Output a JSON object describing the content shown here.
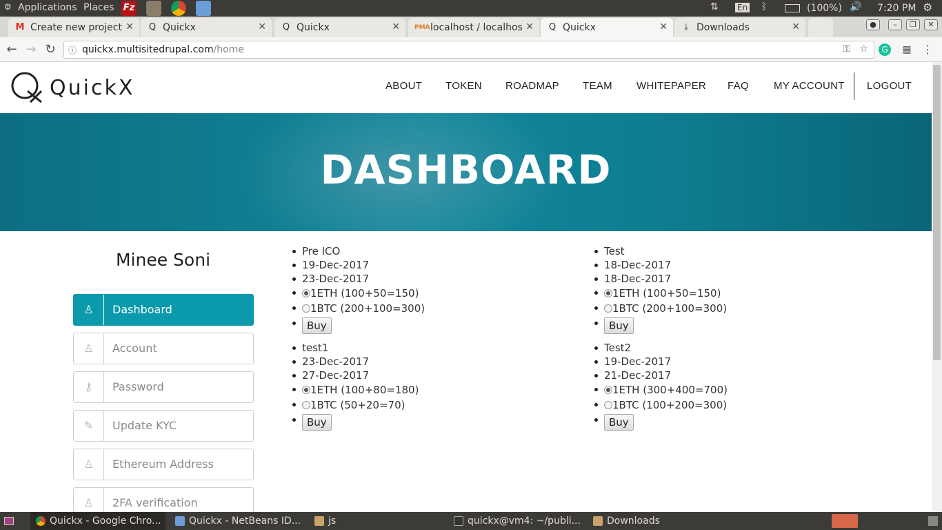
{
  "os": {
    "menus": [
      "Applications",
      "Places"
    ],
    "tray": {
      "battery": "(100%)",
      "keyboard": "En",
      "time": "7:20 PM"
    }
  },
  "browser": {
    "tabs": [
      {
        "title": "Create new project",
        "icon": "gmail-icon"
      },
      {
        "title": "Quickx",
        "icon": "quickx-icon"
      },
      {
        "title": "Quickx",
        "icon": "quickx-icon"
      },
      {
        "title": "localhost / localhos",
        "icon": "phpmyadmin-icon"
      },
      {
        "title": "Quickx",
        "icon": "quickx-icon",
        "active": true
      },
      {
        "title": "Downloads",
        "icon": "download-icon"
      }
    ],
    "url": {
      "host": "quickx.multisitedrupal.com",
      "path": "/home"
    }
  },
  "site": {
    "logo": "QuickX",
    "nav": [
      "ABOUT",
      "TOKEN",
      "ROADMAP",
      "TEAM",
      "WHITEPAPER",
      "FAQ",
      "MY ACCOUNT",
      "LOGOUT"
    ],
    "hero_title": "DASHBOARD",
    "user_name": "Minee Soni",
    "menu": [
      {
        "label": "Dashboard",
        "icon": "user-icon",
        "active": true
      },
      {
        "label": "Account",
        "icon": "user-icon"
      },
      {
        "label": "Password",
        "icon": "key-icon"
      },
      {
        "label": "Update KYC",
        "icon": "pencil-icon"
      },
      {
        "label": "Ethereum Address",
        "icon": "user-icon"
      },
      {
        "label": "2FA verification",
        "icon": "user-icon"
      }
    ],
    "icos": [
      {
        "name": "Pre ICO",
        "start": "19-Dec-2017",
        "end": "23-Dec-2017",
        "eth": "1ETH (100+50=150)",
        "btc": "1BTC (200+100=300)",
        "buy": "Buy"
      },
      {
        "name": "Test",
        "start": "18-Dec-2017",
        "end": "18-Dec-2017",
        "eth": "1ETH (100+50=150)",
        "btc": "1BTC (200+100=300)",
        "buy": "Buy"
      },
      {
        "name": "test1",
        "start": "23-Dec-2017",
        "end": "27-Dec-2017",
        "eth": "1ETH (100+80=180)",
        "btc": "1BTC (50+20=70)",
        "buy": "Buy"
      },
      {
        "name": "Test2",
        "start": "19-Dec-2017",
        "end": "21-Dec-2017",
        "eth": "1ETH (300+400=700)",
        "btc": "1BTC (100+200=300)",
        "buy": "Buy"
      }
    ]
  },
  "taskbar": [
    {
      "label": "Quickx - Google Chro...",
      "icon": "chrome-icon"
    },
    {
      "label": "Quickx - NetBeans ID...",
      "icon": "netbeans-icon"
    },
    {
      "label": "js",
      "icon": "folder-icon"
    },
    {
      "label": "quickx@vm4: ~/publi...",
      "icon": "terminal-icon"
    },
    {
      "label": "Downloads",
      "icon": "folder-icon"
    }
  ]
}
